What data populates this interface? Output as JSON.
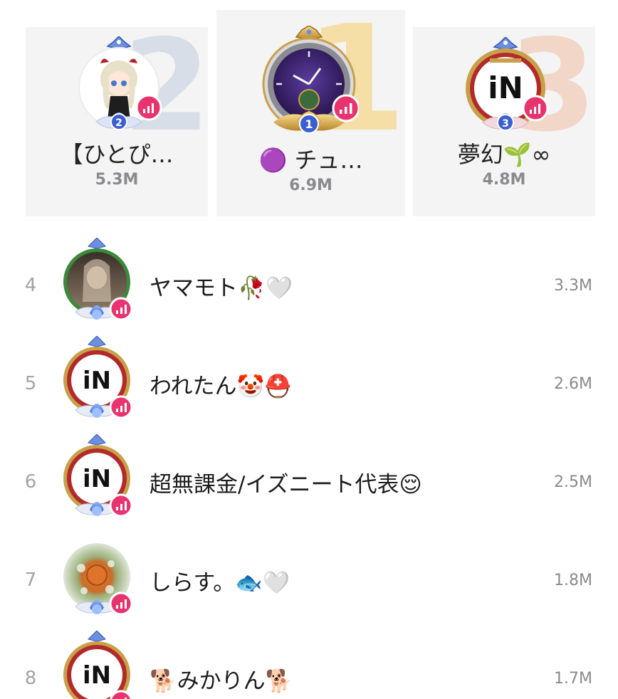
{
  "podium": [
    {
      "rank": "2",
      "name": "【ひとぴ…",
      "score": "5.3M",
      "badge_level": "2"
    },
    {
      "rank": "1",
      "name": "🟣 チュ…",
      "score": "6.9M",
      "badge_level": "1"
    },
    {
      "rank": "3",
      "name": "夢幻🌱∞",
      "score": "4.8M",
      "badge_level": "3"
    }
  ],
  "list": [
    {
      "rank": "4",
      "name": "ヤマモト🥀🤍",
      "score": "3.3M"
    },
    {
      "rank": "5",
      "name": "われたん🤡⛑️",
      "score": "2.6M"
    },
    {
      "rank": "6",
      "name": "超無課金/イズニート代表😌",
      "score": "2.5M"
    },
    {
      "rank": "7",
      "name": "しらす。🐟🤍",
      "score": "1.8M"
    },
    {
      "rank": "8",
      "name": "🐕みかりん🐕",
      "score": "1.7M"
    }
  ],
  "logo_text": "iN",
  "colors": {
    "card_bg": "#f4f4f5",
    "live_badge": "#e8336f",
    "rank2_numeral": "#d8dee7",
    "rank1_numeral": "#f5dfa6",
    "rank3_numeral": "#f2d6c8",
    "gold_frame": "#c9a04a",
    "blue_lotus": "#4a73d6"
  }
}
